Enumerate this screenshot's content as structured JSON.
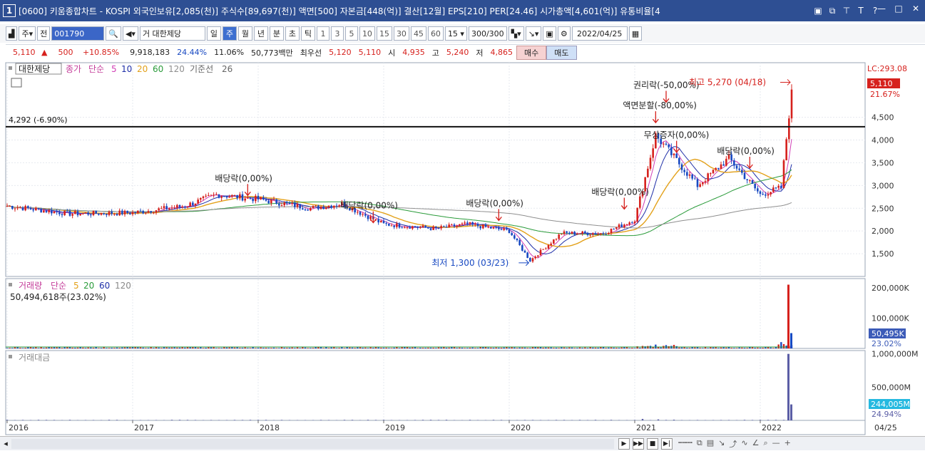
{
  "window": {
    "number": "1",
    "title": "[0600] 키움종합차트 - KOSPI 외국인보유[2,085(천)] 주식수[89,697(천)] 액면[500] 자본금[448(억)] 결산[12월] EPS[210] PER[24.46] 시가총액[4,601(억)] 유통비율[4",
    "title_icons": [
      "▣",
      "⧉",
      "⊤",
      "T",
      "?"
    ],
    "controls": [
      "—",
      "□",
      "✕"
    ]
  },
  "toolbar": {
    "period_type": "주",
    "prev_label": "전",
    "stock_code": "001790",
    "stock_name": "거 대한제당",
    "periods": [
      "일",
      "주",
      "월",
      "년",
      "분",
      "초",
      "틱"
    ],
    "selected_period": "주",
    "intervals": [
      "1",
      "3",
      "5",
      "10",
      "15",
      "30",
      "45",
      "60"
    ],
    "interval_value": "15",
    "count": "300/300",
    "date": "2022/04/25"
  },
  "info": {
    "price": "5,110",
    "change": "500",
    "change_pct": "+10.85%",
    "volume": "9,918,183",
    "ratio1": "24.44%",
    "ratio2": "11.06%",
    "amount": "50,773백만",
    "best_label": "최우선",
    "best_ask": "5,120",
    "best_bid": "5,110",
    "open_label": "시",
    "open": "4,935",
    "high_label": "고",
    "high": "5,240",
    "low_label": "저",
    "low": "4,865",
    "buy_label": "매수",
    "sell_label": "매도"
  },
  "chart_data": {
    "type": "line",
    "title": "",
    "price_legend": {
      "stock": "대한제당",
      "items": [
        "종가",
        "단순",
        "5",
        "10",
        "20",
        "60",
        "120",
        "기준선",
        "26"
      ]
    },
    "volume_legend": [
      "거래량",
      "단순",
      "5",
      "20",
      "60",
      "120"
    ],
    "volume_total": "50,494,618주(23.02%)",
    "amount_legend": "거래대금",
    "x_ticks": [
      "2016",
      "2017",
      "2018",
      "2019",
      "2020",
      "2021",
      "2022"
    ],
    "x_last_label": "04/25",
    "y_price_ticks": [
      1500,
      2000,
      2500,
      3000,
      3500,
      4000,
      4500
    ],
    "y_volume_ticks": [
      "100,000K",
      "200,000K"
    ],
    "y_amount_ticks": [
      "500,000M",
      "1,000,000M"
    ],
    "price_right_labels": {
      "lc": "LC:293.08",
      "last": "5,110",
      "pct": "21.67%"
    },
    "volume_right_labels": {
      "last": "50,495K",
      "pct": "23.02%"
    },
    "amount_right_labels": {
      "last": "244,005M",
      "pct": "24.94%"
    },
    "horizontal_line": {
      "value": 4292,
      "label": "4,292 (-6.90%)"
    },
    "price_series": {
      "dates": [
        "2016-01",
        "2016-07",
        "2017-01",
        "2017-06",
        "2017-09",
        "2018-01",
        "2018-06",
        "2018-09",
        "2019-01",
        "2019-06",
        "2019-09",
        "2020-01",
        "2020-03",
        "2020-06",
        "2020-10",
        "2021-01",
        "2021-03",
        "2021-05",
        "2021-07",
        "2021-10",
        "2022-01",
        "2022-03",
        "2022-04"
      ],
      "close": [
        2550,
        2380,
        2400,
        2550,
        2800,
        2700,
        2500,
        2600,
        2150,
        2050,
        2150,
        2000,
        1350,
        1950,
        1950,
        2250,
        4100,
        3550,
        3000,
        3600,
        2800,
        2950,
        5110
      ]
    },
    "annotations": [
      {
        "label": "배당락(0,00%)",
        "date": "2017-12",
        "value": 2750
      },
      {
        "label": "배당락(0,00%)",
        "date": "2018-12",
        "value": 2150
      },
      {
        "label": "배당락(0,00%)",
        "date": "2019-12",
        "value": 2200
      },
      {
        "label": "최저 1,300 (03/23)",
        "date": "2020-03",
        "value": 1300
      },
      {
        "label": "배당락(0,00%)",
        "date": "2020-12",
        "value": 2450
      },
      {
        "label": "권리락(-50,00%)",
        "date": "2021-04",
        "value": 4800
      },
      {
        "label": "액면분할(-80,00%)",
        "date": "2021-03",
        "value": 4350
      },
      {
        "label": "무상증자(0,00%)",
        "date": "2021-05",
        "value": 3700
      },
      {
        "label": "배당락(0,00%)",
        "date": "2021-12",
        "value": 3350
      },
      {
        "label": "최고 5,270 (04/18)",
        "date": "2022-04",
        "value": 5270
      }
    ],
    "volume_spike": {
      "date": "2022-04",
      "value_k": 210000
    },
    "amount_spike": {
      "date": "2022-04",
      "value_m": 1000000
    },
    "colors": {
      "up": "#d6211d",
      "down": "#1849c2",
      "ma5": "#d13fb6",
      "ma10": "#1f2fa8",
      "ma20": "#e3a11a",
      "ma60": "#2a9b3a",
      "ma120": "#8f8f8f",
      "base": "#333333"
    }
  }
}
